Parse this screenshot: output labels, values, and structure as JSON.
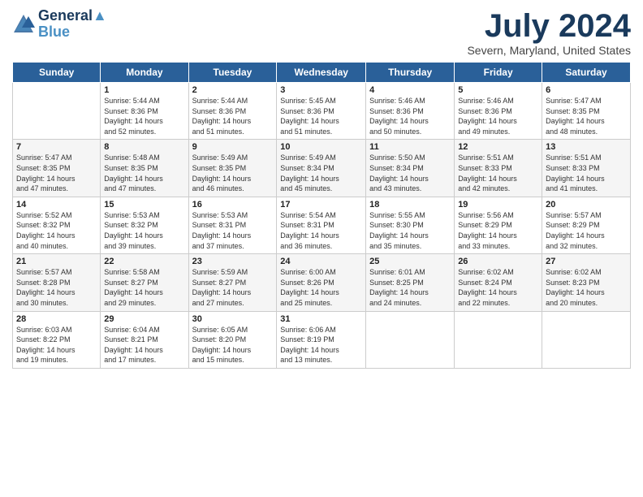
{
  "header": {
    "logo_line1": "General",
    "logo_line2": "Blue",
    "month_year": "July 2024",
    "location": "Severn, Maryland, United States"
  },
  "days_of_week": [
    "Sunday",
    "Monday",
    "Tuesday",
    "Wednesday",
    "Thursday",
    "Friday",
    "Saturday"
  ],
  "weeks": [
    [
      {
        "day": "",
        "info": ""
      },
      {
        "day": "1",
        "info": "Sunrise: 5:44 AM\nSunset: 8:36 PM\nDaylight: 14 hours\nand 52 minutes."
      },
      {
        "day": "2",
        "info": "Sunrise: 5:44 AM\nSunset: 8:36 PM\nDaylight: 14 hours\nand 51 minutes."
      },
      {
        "day": "3",
        "info": "Sunrise: 5:45 AM\nSunset: 8:36 PM\nDaylight: 14 hours\nand 51 minutes."
      },
      {
        "day": "4",
        "info": "Sunrise: 5:46 AM\nSunset: 8:36 PM\nDaylight: 14 hours\nand 50 minutes."
      },
      {
        "day": "5",
        "info": "Sunrise: 5:46 AM\nSunset: 8:36 PM\nDaylight: 14 hours\nand 49 minutes."
      },
      {
        "day": "6",
        "info": "Sunrise: 5:47 AM\nSunset: 8:35 PM\nDaylight: 14 hours\nand 48 minutes."
      }
    ],
    [
      {
        "day": "7",
        "info": "Sunrise: 5:47 AM\nSunset: 8:35 PM\nDaylight: 14 hours\nand 47 minutes."
      },
      {
        "day": "8",
        "info": "Sunrise: 5:48 AM\nSunset: 8:35 PM\nDaylight: 14 hours\nand 47 minutes."
      },
      {
        "day": "9",
        "info": "Sunrise: 5:49 AM\nSunset: 8:35 PM\nDaylight: 14 hours\nand 46 minutes."
      },
      {
        "day": "10",
        "info": "Sunrise: 5:49 AM\nSunset: 8:34 PM\nDaylight: 14 hours\nand 45 minutes."
      },
      {
        "day": "11",
        "info": "Sunrise: 5:50 AM\nSunset: 8:34 PM\nDaylight: 14 hours\nand 43 minutes."
      },
      {
        "day": "12",
        "info": "Sunrise: 5:51 AM\nSunset: 8:33 PM\nDaylight: 14 hours\nand 42 minutes."
      },
      {
        "day": "13",
        "info": "Sunrise: 5:51 AM\nSunset: 8:33 PM\nDaylight: 14 hours\nand 41 minutes."
      }
    ],
    [
      {
        "day": "14",
        "info": "Sunrise: 5:52 AM\nSunset: 8:32 PM\nDaylight: 14 hours\nand 40 minutes."
      },
      {
        "day": "15",
        "info": "Sunrise: 5:53 AM\nSunset: 8:32 PM\nDaylight: 14 hours\nand 39 minutes."
      },
      {
        "day": "16",
        "info": "Sunrise: 5:53 AM\nSunset: 8:31 PM\nDaylight: 14 hours\nand 37 minutes."
      },
      {
        "day": "17",
        "info": "Sunrise: 5:54 AM\nSunset: 8:31 PM\nDaylight: 14 hours\nand 36 minutes."
      },
      {
        "day": "18",
        "info": "Sunrise: 5:55 AM\nSunset: 8:30 PM\nDaylight: 14 hours\nand 35 minutes."
      },
      {
        "day": "19",
        "info": "Sunrise: 5:56 AM\nSunset: 8:29 PM\nDaylight: 14 hours\nand 33 minutes."
      },
      {
        "day": "20",
        "info": "Sunrise: 5:57 AM\nSunset: 8:29 PM\nDaylight: 14 hours\nand 32 minutes."
      }
    ],
    [
      {
        "day": "21",
        "info": "Sunrise: 5:57 AM\nSunset: 8:28 PM\nDaylight: 14 hours\nand 30 minutes."
      },
      {
        "day": "22",
        "info": "Sunrise: 5:58 AM\nSunset: 8:27 PM\nDaylight: 14 hours\nand 29 minutes."
      },
      {
        "day": "23",
        "info": "Sunrise: 5:59 AM\nSunset: 8:27 PM\nDaylight: 14 hours\nand 27 minutes."
      },
      {
        "day": "24",
        "info": "Sunrise: 6:00 AM\nSunset: 8:26 PM\nDaylight: 14 hours\nand 25 minutes."
      },
      {
        "day": "25",
        "info": "Sunrise: 6:01 AM\nSunset: 8:25 PM\nDaylight: 14 hours\nand 24 minutes."
      },
      {
        "day": "26",
        "info": "Sunrise: 6:02 AM\nSunset: 8:24 PM\nDaylight: 14 hours\nand 22 minutes."
      },
      {
        "day": "27",
        "info": "Sunrise: 6:02 AM\nSunset: 8:23 PM\nDaylight: 14 hours\nand 20 minutes."
      }
    ],
    [
      {
        "day": "28",
        "info": "Sunrise: 6:03 AM\nSunset: 8:22 PM\nDaylight: 14 hours\nand 19 minutes."
      },
      {
        "day": "29",
        "info": "Sunrise: 6:04 AM\nSunset: 8:21 PM\nDaylight: 14 hours\nand 17 minutes."
      },
      {
        "day": "30",
        "info": "Sunrise: 6:05 AM\nSunset: 8:20 PM\nDaylight: 14 hours\nand 15 minutes."
      },
      {
        "day": "31",
        "info": "Sunrise: 6:06 AM\nSunset: 8:19 PM\nDaylight: 14 hours\nand 13 minutes."
      },
      {
        "day": "",
        "info": ""
      },
      {
        "day": "",
        "info": ""
      },
      {
        "day": "",
        "info": ""
      }
    ]
  ]
}
